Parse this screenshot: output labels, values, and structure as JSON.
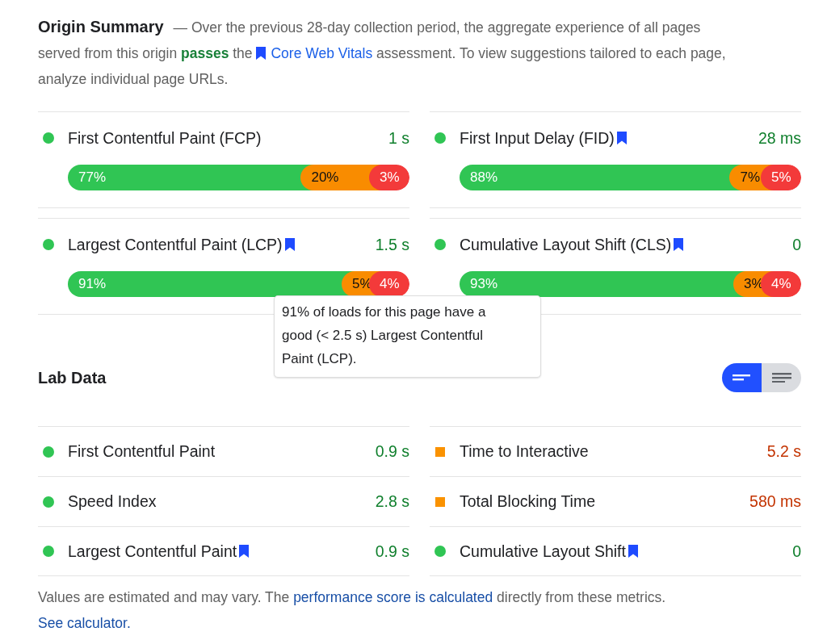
{
  "origin_summary": {
    "title": "Origin Summary",
    "description": {
      "before": "— Over the previous 28-day collection period, the aggregate experience of all pages served from this origin",
      "verdict": "passes",
      "middle": "the",
      "link": "Core Web Vitals",
      "after": "assessment. To view suggestions tailored to each page, analyze individual page URLs."
    },
    "metrics": [
      {
        "name": "First Contentful Paint (FCP)",
        "value": "1 s",
        "kind": "good",
        "core_web_vital": false,
        "distribution": [
          {
            "kind": "good",
            "label": "77%"
          },
          {
            "kind": "average",
            "label": "20%"
          },
          {
            "kind": "poor",
            "label": "3%"
          }
        ]
      },
      {
        "name": "First Input Delay (FID)",
        "value": "28 ms",
        "kind": "good",
        "core_web_vital": true,
        "distribution": [
          {
            "kind": "good",
            "label": "88%"
          },
          {
            "kind": "average",
            "label": "7%"
          },
          {
            "kind": "poor",
            "label": "5%"
          }
        ]
      },
      {
        "name": "Largest Contentful Paint (LCP)",
        "value": "1.5 s",
        "kind": "good",
        "core_web_vital": true,
        "tooltip": "91% of loads for this page have a good (< 2.5 s) Largest Contentful Paint (LCP).",
        "distribution": [
          {
            "kind": "good",
            "label": "91%"
          },
          {
            "kind": "average",
            "label": "5%"
          },
          {
            "kind": "poor",
            "label": "4%"
          }
        ]
      },
      {
        "name": "Cumulative Layout Shift (CLS)",
        "value": "0",
        "kind": "good",
        "core_web_vital": true,
        "distribution": [
          {
            "kind": "good",
            "label": "93%"
          },
          {
            "kind": "average",
            "label": "3%"
          },
          {
            "kind": "poor",
            "label": "4%"
          }
        ]
      }
    ]
  },
  "lab_data": {
    "title": "Lab Data",
    "view_toggle": [
      {
        "kind": "summary",
        "selected": true
      },
      {
        "kind": "detailed",
        "selected": false
      }
    ],
    "metrics": [
      {
        "name": "First Contentful Paint",
        "value": "0.9 s",
        "kind": "good",
        "core_web_vital": false
      },
      {
        "name": "Time to Interactive",
        "value": "5.2 s",
        "kind": "average",
        "core_web_vital": false
      },
      {
        "name": "Speed Index",
        "value": "2.8 s",
        "kind": "good",
        "core_web_vital": false
      },
      {
        "name": "Total Blocking Time",
        "value": "580 ms",
        "kind": "average",
        "core_web_vital": false
      },
      {
        "name": "Largest Contentful Paint",
        "value": "0.9 s",
        "kind": "good",
        "core_web_vital": true
      },
      {
        "name": "Cumulative Layout Shift",
        "value": "0",
        "kind": "good",
        "core_web_vital": true
      }
    ]
  },
  "footer": {
    "before": "Values are estimated and may vary. The",
    "link": "performance score is calculated",
    "middle": "directly from these metrics.",
    "link_2": "See calculator."
  }
}
